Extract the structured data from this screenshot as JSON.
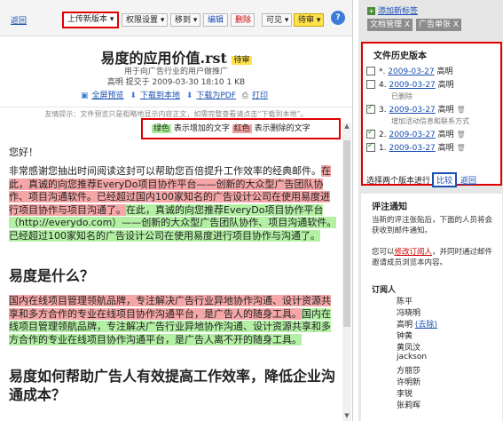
{
  "toolbar": {
    "back": "返回",
    "upload": "上传新版本 ▾",
    "perm": "权限设置 ▾",
    "move": "移到 ▾",
    "edit": "编辑",
    "delete": "删除",
    "visible": "可见 ▾",
    "pending": "待审 ▾"
  },
  "doc": {
    "title": "易度的应用价值.rst",
    "badge": "待审",
    "subtitle": "用于向广告行业的用户做推广",
    "meta": "高明 提交于 2009-03-30 18:10 1 KB",
    "actions": [
      "全屏预览",
      "下载到本地",
      "下载为PDF",
      "打印"
    ],
    "hint": "友情提示：文件预览只是粗略地显示内容正文，如需完整查看请点击“下载到本地”。"
  },
  "legend": {
    "add_word": "绿色",
    "add_text": "表示增加的文字",
    "del_word": "红色",
    "del_text": "表示删除的文字"
  },
  "content": {
    "hello": "您好！",
    "p1_plain": "非常感谢您抽出时间阅读这封可以帮助您百倍提升工作效率的经典邮件。",
    "p1_del": "在此，真诚的向您推荐EveryDo项目协作平台——创新的大众型广告团队协作、项目沟通软件。已经超过国内100家知名的广告设计公司在使用易度进行项目协作与项目沟通了。",
    "p1_ins": "在此，真诚的向您推荐EveryDo项目协作平台（http://everydo.com）——创新的大众型广告团队协作、项目沟通软件。已经超过100家知名的广告设计公司在使用易度进行项目协作与沟通了。",
    "h1": "易度是什么？",
    "p2_del": "国内在线项目管理领航品牌，专注解决广告行业异地协作沟通、设计资源共享和多方合作的专业在线项目协作沟通平台，是广告人的随身工具。",
    "p2_ins": "国内在线项目管理领航品牌，专注解决广告行业异地协作沟通、设计资源共享和多方合作的专业在线项目协作沟通平台，是广告人离不开的随身工具。",
    "h2": "易度如何帮助广告人有效提高工作效率，降低企业沟通成本？"
  },
  "sidebar": {
    "add_tag": "添加新标签",
    "tags": [
      "文档管理 X",
      "广告单张 X"
    ],
    "history_title": "文件历史版本",
    "versions": [
      {
        "num": "*.",
        "date": "2009-03-27",
        "author": "高明",
        "checked": false,
        "trash": false,
        "note": ""
      },
      {
        "num": "4.",
        "date": "2009-03-27",
        "author": "高明",
        "checked": false,
        "trash": false,
        "note": "已删除"
      },
      {
        "num": "3.",
        "date": "2009-03-27",
        "author": "高明",
        "checked": true,
        "trash": true,
        "note": "增加活动信息和联系方式"
      },
      {
        "num": "2.",
        "date": "2009-03-27",
        "author": "高明",
        "checked": true,
        "trash": true,
        "note": ""
      },
      {
        "num": "1.",
        "date": "2009-03-27",
        "author": "高明",
        "checked": true,
        "trash": true,
        "note": ""
      }
    ],
    "compare_label": "选择两个版本进行",
    "compare_btn": "比较",
    "compare_back": "返回",
    "notify_title": "评注通知",
    "notify_text1": "当新的评注张贴后，下面的人员将会获收到邮件通知。",
    "notify_text2a": "您可以",
    "notify_link": "修改订阅人",
    "notify_text2b": "，并同时通过邮件邀请成员浏览本内容。",
    "subscribers_title": "订阅人",
    "subscribers": [
      "陈平",
      "冯晓明",
      "高明",
      "钟黄",
      "黄凤汶",
      "jackson",
      "方丽莎",
      "许明新",
      "李锐",
      "张莉晖"
    ],
    "remove_label": "(去除)"
  },
  "colors": {
    "accent": "#1a4fb3",
    "highlight_red": "#e00000",
    "insert": "#b3f0a4",
    "delete": "#f5a6a6",
    "pending": "#ffe14a"
  }
}
